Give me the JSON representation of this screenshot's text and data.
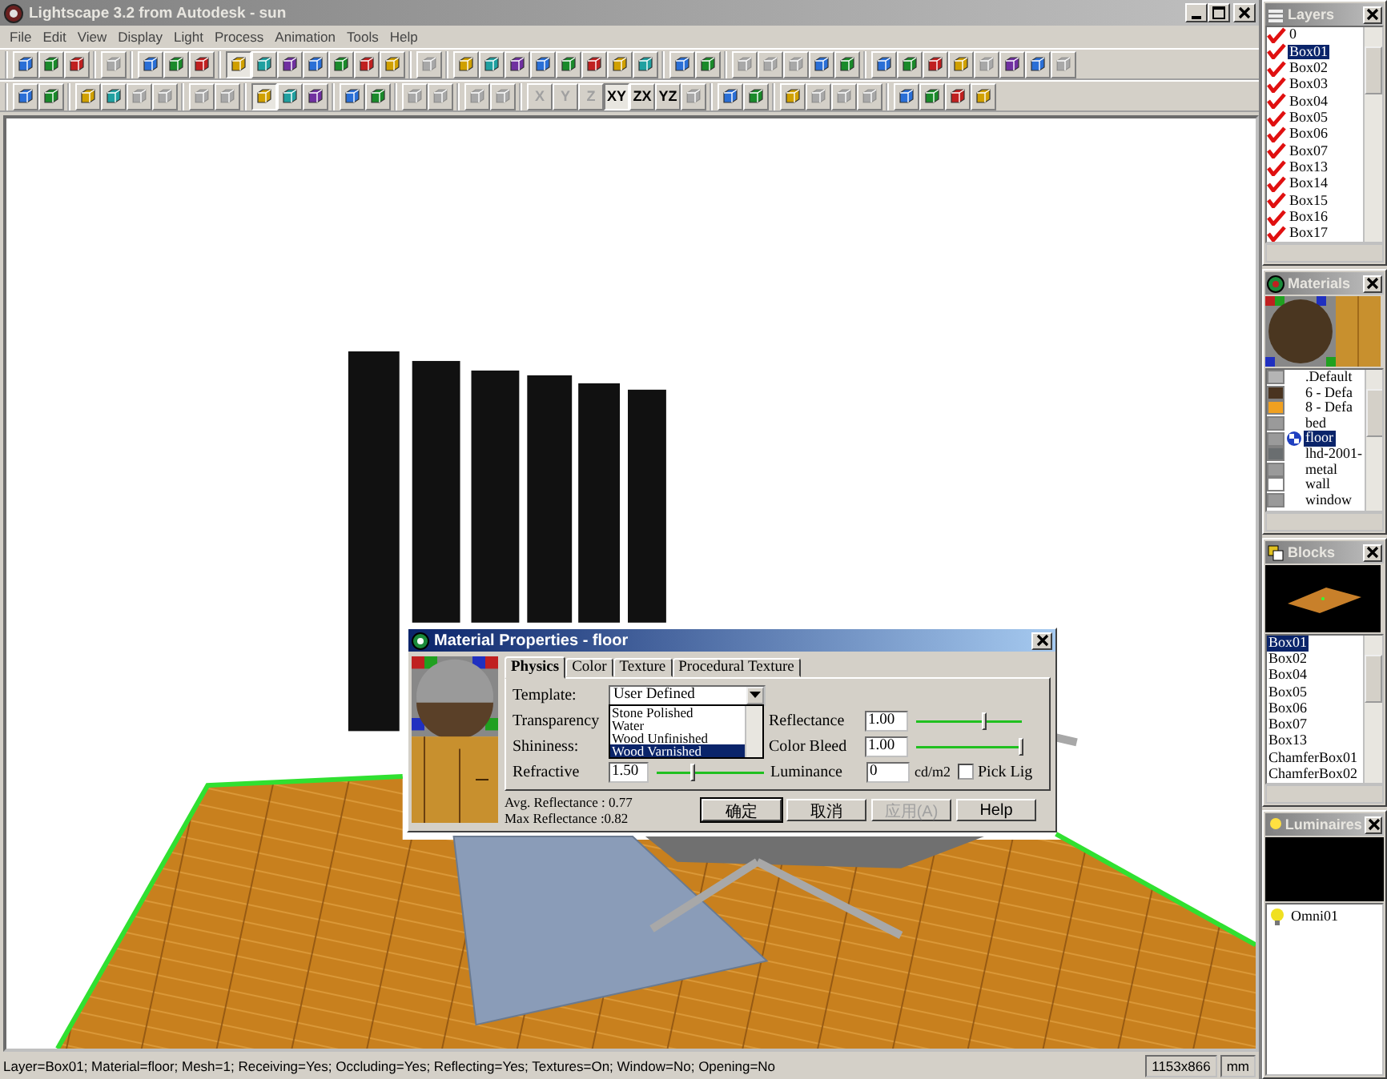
{
  "window": {
    "title": "Lightscape 3.2 from Autodesk - sun"
  },
  "menu": [
    "File",
    "Edit",
    "View",
    "Display",
    "Light",
    "Process",
    "Animation",
    "Tools",
    "Help"
  ],
  "toolbars": [
    [
      [
        {
          "disabled": false,
          "pressed": false
        },
        {
          "disabled": false,
          "pressed": false
        },
        {
          "disabled": false,
          "pressed": false
        }
      ],
      [
        {
          "disabled": true,
          "pressed": false
        }
      ],
      [
        {
          "disabled": false,
          "pressed": false
        },
        {
          "disabled": false,
          "pressed": false
        },
        {
          "disabled": false,
          "pressed": false
        }
      ],
      [
        {
          "disabled": false,
          "pressed": true
        },
        {
          "disabled": false,
          "pressed": false
        },
        {
          "disabled": false,
          "pressed": false
        },
        {
          "disabled": false,
          "pressed": false
        },
        {
          "disabled": false,
          "pressed": false
        },
        {
          "disabled": false,
          "pressed": false
        },
        {
          "disabled": false,
          "pressed": false
        }
      ],
      [
        {
          "disabled": true,
          "pressed": false
        }
      ],
      [
        {
          "disabled": false,
          "pressed": false
        },
        {
          "disabled": false,
          "pressed": false
        },
        {
          "disabled": false,
          "pressed": false
        },
        {
          "disabled": false,
          "pressed": false
        },
        {
          "disabled": false,
          "pressed": false
        },
        {
          "disabled": false,
          "pressed": false
        },
        {
          "disabled": false,
          "pressed": false
        },
        {
          "disabled": false,
          "pressed": false
        }
      ],
      [
        {
          "disabled": false,
          "pressed": false
        },
        {
          "disabled": false,
          "pressed": false
        }
      ],
      [
        {
          "disabled": true,
          "pressed": false
        },
        {
          "disabled": true,
          "pressed": false
        },
        {
          "disabled": true,
          "pressed": false
        },
        {
          "disabled": false,
          "pressed": false
        },
        {
          "disabled": false,
          "pressed": false
        }
      ],
      [
        {
          "disabled": false,
          "pressed": false
        },
        {
          "disabled": false,
          "pressed": false
        },
        {
          "disabled": false,
          "pressed": false
        },
        {
          "disabled": false,
          "pressed": false
        },
        {
          "disabled": true,
          "pressed": false
        },
        {
          "disabled": false,
          "pressed": false
        },
        {
          "disabled": false,
          "pressed": false
        },
        {
          "disabled": true,
          "pressed": false
        }
      ]
    ],
    [
      [
        {
          "disabled": false,
          "pressed": false
        },
        {
          "disabled": false,
          "pressed": false
        }
      ],
      [
        {
          "disabled": false,
          "pressed": false
        },
        {
          "disabled": false,
          "pressed": false
        },
        {
          "disabled": true,
          "pressed": false
        },
        {
          "disabled": true,
          "pressed": false
        }
      ],
      [
        {
          "disabled": true,
          "pressed": false
        },
        {
          "disabled": true,
          "pressed": false
        }
      ],
      [
        {
          "disabled": false,
          "pressed": true
        },
        {
          "disabled": false,
          "pressed": false
        },
        {
          "disabled": false,
          "pressed": false
        }
      ],
      [
        {
          "disabled": false,
          "pressed": false
        },
        {
          "disabled": false,
          "pressed": false
        }
      ],
      [
        {
          "disabled": true,
          "pressed": false
        },
        {
          "disabled": true,
          "pressed": false
        }
      ],
      [
        {
          "disabled": true,
          "pressed": false
        },
        {
          "disabled": true,
          "pressed": false
        }
      ],
      [
        {
          "disabled": true,
          "pressed": false,
          "label": "X"
        },
        {
          "disabled": true,
          "pressed": false,
          "label": "Y"
        },
        {
          "disabled": true,
          "pressed": false,
          "label": "Z"
        },
        {
          "disabled": false,
          "pressed": true,
          "label": "XY"
        },
        {
          "disabled": false,
          "pressed": false,
          "label": "ZX"
        },
        {
          "disabled": false,
          "pressed": false,
          "label": "YZ"
        },
        {
          "disabled": true,
          "pressed": false
        }
      ],
      [
        {
          "disabled": false,
          "pressed": false
        },
        {
          "disabled": false,
          "pressed": false
        }
      ],
      [
        {
          "disabled": false,
          "pressed": false
        },
        {
          "disabled": true,
          "pressed": false
        },
        {
          "disabled": true,
          "pressed": false
        },
        {
          "disabled": true,
          "pressed": false
        }
      ],
      [
        {
          "disabled": false,
          "pressed": false
        },
        {
          "disabled": false,
          "pressed": false
        },
        {
          "disabled": false,
          "pressed": false
        },
        {
          "disabled": false,
          "pressed": false
        }
      ]
    ]
  ],
  "dialog": {
    "title": "Material Properties - floor",
    "tabs": [
      {
        "label": "Physics",
        "selected": true
      },
      {
        "label": "Color",
        "selected": false
      },
      {
        "label": "Texture",
        "selected": false
      },
      {
        "label": "Procedural Texture",
        "selected": false
      }
    ],
    "template": {
      "label": "Template:",
      "value": "User Defined",
      "options": [
        {
          "label": "Stone Polished",
          "selected": false
        },
        {
          "label": "Water",
          "selected": false
        },
        {
          "label": "Wood Unfinished",
          "selected": false
        },
        {
          "label": "Wood Varnished",
          "selected": true
        }
      ]
    },
    "transparency": {
      "label": "Transparency"
    },
    "shininess": {
      "label": "Shininess:"
    },
    "refractive": {
      "label": "Refractive",
      "value": "1.50",
      "level": 0.35
    },
    "reflectance": {
      "label": "Reflectance",
      "value": "1.00",
      "level": 0.65
    },
    "color_bleed": {
      "label": "Color Bleed",
      "value": "1.00",
      "level": 1.0
    },
    "luminance": {
      "label": "Luminance",
      "value": "0",
      "unit": "cd/m2"
    },
    "pick_light": {
      "label": "Pick Lig",
      "checked": false
    },
    "avg_reflectance": "Avg. Reflectance : 0.77",
    "max_reflectance": "Max Reflectance :0.82",
    "buttons": [
      {
        "label": "确定",
        "disabled": false,
        "default": true
      },
      {
        "label": "取消",
        "disabled": false,
        "default": false
      },
      {
        "label": "应用(A)",
        "disabled": true,
        "default": false
      },
      {
        "label": "Help",
        "disabled": false,
        "default": false
      }
    ]
  },
  "status_bar": {
    "text": "Layer=Box01; Material=floor; Mesh=1; Receiving=Yes; Occluding=Yes; Reflecting=Yes; Textures=On; Window=No; Opening=No",
    "size": "1153x866",
    "units": "mm"
  },
  "layers": {
    "title": "Layers",
    "items": [
      {
        "label": "0",
        "checked": true,
        "selected": false
      },
      {
        "label": "Box01",
        "checked": true,
        "selected": true
      },
      {
        "label": "Box02",
        "checked": true,
        "selected": false
      },
      {
        "label": "Box03",
        "checked": true,
        "selected": false
      },
      {
        "label": "Box04",
        "checked": true,
        "selected": false
      },
      {
        "label": "Box05",
        "checked": true,
        "selected": false
      },
      {
        "label": "Box06",
        "checked": true,
        "selected": false
      },
      {
        "label": "Box07",
        "checked": true,
        "selected": false
      },
      {
        "label": "Box13",
        "checked": true,
        "selected": false
      },
      {
        "label": "Box14",
        "checked": true,
        "selected": false
      },
      {
        "label": "Box15",
        "checked": true,
        "selected": false
      },
      {
        "label": "Box16",
        "checked": true,
        "selected": false
      },
      {
        "label": "Box17",
        "checked": true,
        "selected": false
      }
    ]
  },
  "materials": {
    "title": "Materials",
    "items": [
      {
        "label": ".Default",
        "color": "#b4b4b4",
        "selected": false
      },
      {
        "label": "6 - Defa",
        "color": "#4a3420",
        "selected": false
      },
      {
        "label": "8 - Defa",
        "color": "#f0a020",
        "selected": false
      },
      {
        "label": "bed",
        "color": "#9a9a9a",
        "selected": false
      },
      {
        "label": "floor",
        "color": "#9a9a9a",
        "selected": true
      },
      {
        "label": "lhd-2001-",
        "color": "#6a6e70",
        "selected": false
      },
      {
        "label": "metal",
        "color": "#9a9a9a",
        "selected": false
      },
      {
        "label": "wall",
        "color": "#ffffff",
        "selected": false
      },
      {
        "label": "window",
        "color": "#9a9a9a",
        "selected": false
      }
    ]
  },
  "blocks": {
    "title": "Blocks",
    "items": [
      {
        "label": "Box01",
        "selected": true
      },
      {
        "label": "Box02",
        "selected": false
      },
      {
        "label": "Box04",
        "selected": false
      },
      {
        "label": "Box05",
        "selected": false
      },
      {
        "label": "Box06",
        "selected": false
      },
      {
        "label": "Box07",
        "selected": false
      },
      {
        "label": "Box13",
        "selected": false
      },
      {
        "label": "ChamferBox01",
        "selected": false
      },
      {
        "label": "ChamferBox02",
        "selected": false
      }
    ]
  },
  "luminaires": {
    "title": "Luminaires",
    "items": [
      {
        "label": "Omni01"
      }
    ]
  }
}
